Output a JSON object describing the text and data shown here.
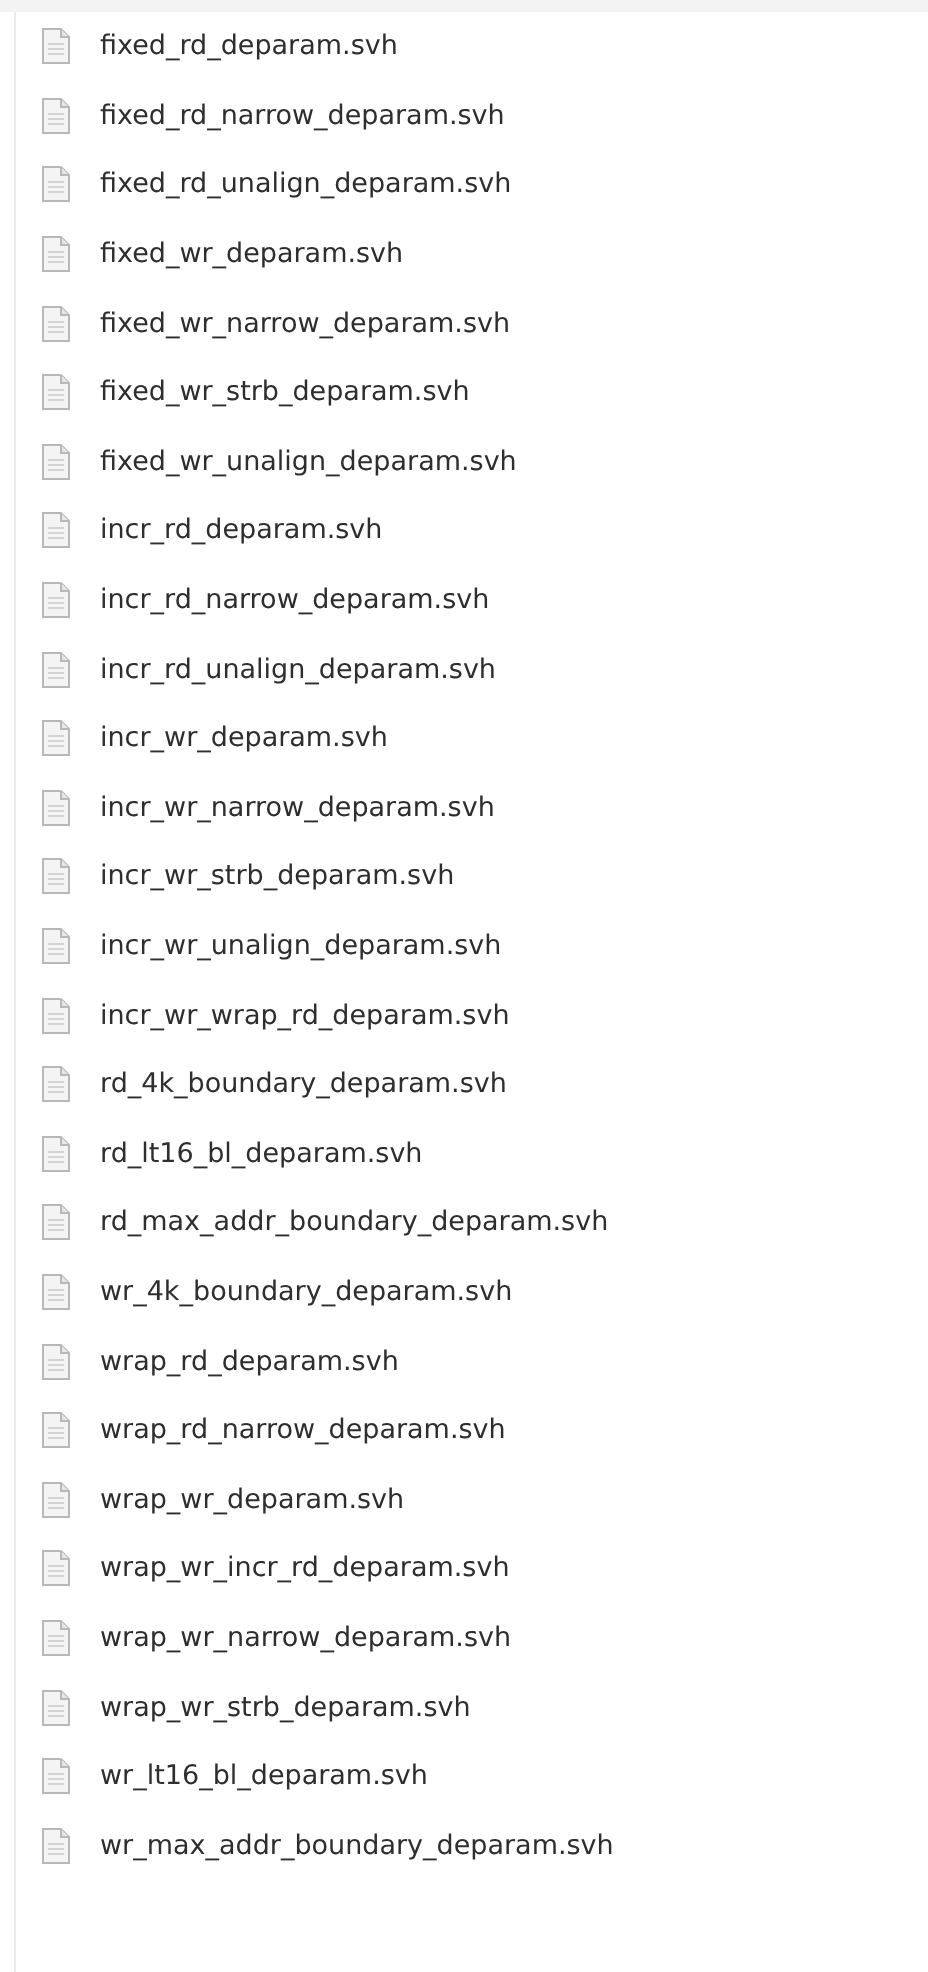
{
  "files": [
    {
      "name": "fixed_rd_deparam.svh"
    },
    {
      "name": "fixed_rd_narrow_deparam.svh"
    },
    {
      "name": "fixed_rd_unalign_deparam.svh"
    },
    {
      "name": "fixed_wr_deparam.svh"
    },
    {
      "name": "fixed_wr_narrow_deparam.svh"
    },
    {
      "name": "fixed_wr_strb_deparam.svh"
    },
    {
      "name": "fixed_wr_unalign_deparam.svh"
    },
    {
      "name": "incr_rd_deparam.svh"
    },
    {
      "name": "incr_rd_narrow_deparam.svh"
    },
    {
      "name": "incr_rd_unalign_deparam.svh"
    },
    {
      "name": "incr_wr_deparam.svh"
    },
    {
      "name": "incr_wr_narrow_deparam.svh"
    },
    {
      "name": "incr_wr_strb_deparam.svh"
    },
    {
      "name": "incr_wr_unalign_deparam.svh"
    },
    {
      "name": "incr_wr_wrap_rd_deparam.svh"
    },
    {
      "name": "rd_4k_boundary_deparam.svh"
    },
    {
      "name": "rd_lt16_bl_deparam.svh"
    },
    {
      "name": "rd_max_addr_boundary_deparam.svh"
    },
    {
      "name": "wr_4k_boundary_deparam.svh"
    },
    {
      "name": "wrap_rd_deparam.svh"
    },
    {
      "name": "wrap_rd_narrow_deparam.svh"
    },
    {
      "name": "wrap_wr_deparam.svh"
    },
    {
      "name": "wrap_wr_incr_rd_deparam.svh"
    },
    {
      "name": "wrap_wr_narrow_deparam.svh"
    },
    {
      "name": "wrap_wr_strb_deparam.svh"
    },
    {
      "name": "wr_lt16_bl_deparam.svh"
    },
    {
      "name": "wr_max_addr_boundary_deparam.svh"
    }
  ]
}
